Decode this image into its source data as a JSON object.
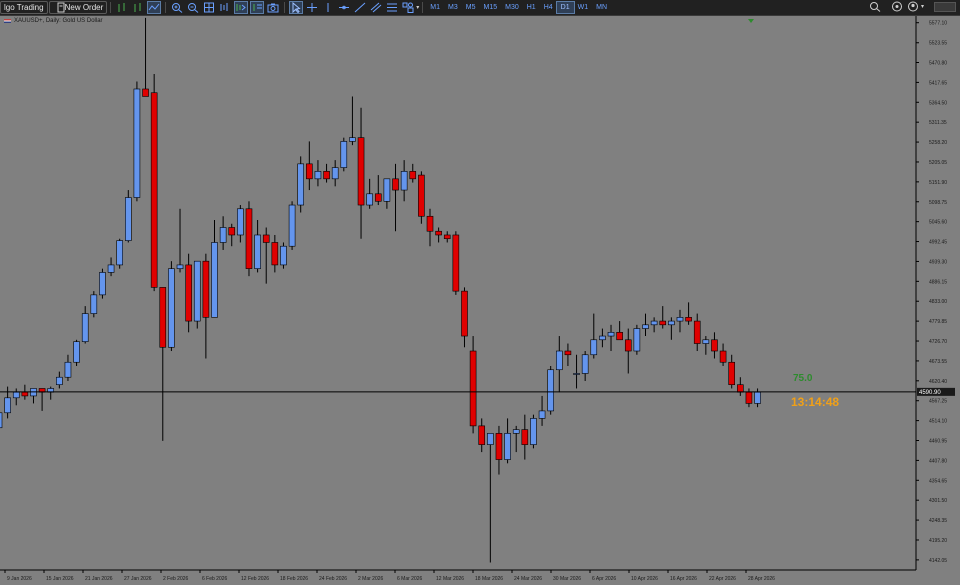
{
  "toolbar": {
    "algo_trading_label": "lgo Trading",
    "new_order_label": "New Order",
    "timeframes": [
      "M1",
      "M3",
      "M5",
      "M15",
      "M30",
      "H1",
      "H4",
      "D1",
      "W1",
      "MN"
    ],
    "active_timeframe": "D1"
  },
  "chart": {
    "symbol_label": "XAUUSD+, Daily: Gold US Dollar",
    "background_color": "#808080",
    "bull_color": "#6495ed",
    "bear_color": "#e00000",
    "price_levels": [
      "5577.10",
      "5523.55",
      "5470.80",
      "5417.65",
      "5364.50",
      "5311.35",
      "5258.20",
      "5205.05",
      "5151.90",
      "5098.75",
      "5045.60",
      "4992.45",
      "4939.30",
      "4886.15",
      "4833.00",
      "4779.85",
      "4726.70",
      "4673.55",
      "4620.40",
      "4567.25",
      "4514.10",
      "4460.95",
      "4407.80",
      "4354.65",
      "4301.50",
      "4248.35",
      "4195.20",
      "4142.05"
    ],
    "current_price": "4590.90",
    "date_labels": [
      "9 Jan 2026",
      "15 Jan 2026",
      "21 Jan 2026",
      "27 Jan 2026",
      "2 Feb 2026",
      "6 Feb 2026",
      "12 Feb 2026",
      "18 Feb 2026",
      "24 Feb 2026",
      "2 Mar 2026",
      "6 Mar 2026",
      "12 Mar 2026",
      "18 Mar 2026",
      "24 Mar 2026",
      "30 Mar 2026",
      "6 Apr 2026",
      "10 Apr 2026",
      "16 Apr 2026",
      "22 Apr 2026",
      "28 Apr 2026"
    ],
    "spread_label": "75.0",
    "countdown": "13:14:48"
  },
  "chart_data": {
    "type": "candlestick",
    "y_range": [
      4115,
      5595
    ],
    "candles": [
      {
        "o": 4495,
        "h": 4560,
        "l": 4480,
        "c": 4535
      },
      {
        "o": 4535,
        "h": 4605,
        "l": 4520,
        "c": 4575
      },
      {
        "o": 4575,
        "h": 4600,
        "l": 4555,
        "c": 4590
      },
      {
        "o": 4590,
        "h": 4610,
        "l": 4570,
        "c": 4580
      },
      {
        "o": 4580,
        "h": 4600,
        "l": 4560,
        "c": 4600
      },
      {
        "o": 4600,
        "h": 4600,
        "l": 4540,
        "c": 4590
      },
      {
        "o": 4590,
        "h": 4605,
        "l": 4570,
        "c": 4600
      },
      {
        "o": 4610,
        "h": 4645,
        "l": 4600,
        "c": 4630
      },
      {
        "o": 4630,
        "h": 4690,
        "l": 4620,
        "c": 4670
      },
      {
        "o": 4670,
        "h": 4730,
        "l": 4660,
        "c": 4725
      },
      {
        "o": 4725,
        "h": 4820,
        "l": 4720,
        "c": 4800
      },
      {
        "o": 4800,
        "h": 4860,
        "l": 4790,
        "c": 4850
      },
      {
        "o": 4850,
        "h": 4920,
        "l": 4840,
        "c": 4910
      },
      {
        "o": 4910,
        "h": 4950,
        "l": 4900,
        "c": 4930
      },
      {
        "o": 4930,
        "h": 5000,
        "l": 4920,
        "c": 4995
      },
      {
        "o": 4995,
        "h": 5130,
        "l": 4990,
        "c": 5110
      },
      {
        "o": 5110,
        "h": 5420,
        "l": 5100,
        "c": 5400
      },
      {
        "o": 5400,
        "h": 5590,
        "l": 5390,
        "c": 5380
      },
      {
        "o": 5390,
        "h": 5440,
        "l": 4860,
        "c": 4870
      },
      {
        "o": 4870,
        "h": 4870,
        "l": 4460,
        "c": 4710
      },
      {
        "o": 4710,
        "h": 4940,
        "l": 4700,
        "c": 4920
      },
      {
        "o": 4920,
        "h": 5080,
        "l": 4910,
        "c": 4930
      },
      {
        "o": 4930,
        "h": 4960,
        "l": 4750,
        "c": 4780
      },
      {
        "o": 4780,
        "h": 4900,
        "l": 4760,
        "c": 4940
      },
      {
        "o": 4940,
        "h": 4960,
        "l": 4680,
        "c": 4790
      },
      {
        "o": 4790,
        "h": 5050,
        "l": 4790,
        "c": 4990
      },
      {
        "o": 4990,
        "h": 5060,
        "l": 4970,
        "c": 5030
      },
      {
        "o": 5030,
        "h": 5040,
        "l": 4980,
        "c": 5010
      },
      {
        "o": 5010,
        "h": 5090,
        "l": 4990,
        "c": 5080
      },
      {
        "o": 5080,
        "h": 5100,
        "l": 4900,
        "c": 4920
      },
      {
        "o": 4920,
        "h": 5050,
        "l": 4910,
        "c": 5010
      },
      {
        "o": 5010,
        "h": 5030,
        "l": 4880,
        "c": 4990
      },
      {
        "o": 4990,
        "h": 5010,
        "l": 4910,
        "c": 4930
      },
      {
        "o": 4930,
        "h": 4990,
        "l": 4920,
        "c": 4980
      },
      {
        "o": 4980,
        "h": 5100,
        "l": 4970,
        "c": 5090
      },
      {
        "o": 5090,
        "h": 5220,
        "l": 5070,
        "c": 5200
      },
      {
        "o": 5200,
        "h": 5260,
        "l": 5130,
        "c": 5160
      },
      {
        "o": 5160,
        "h": 5210,
        "l": 5140,
        "c": 5180
      },
      {
        "o": 5180,
        "h": 5200,
        "l": 5150,
        "c": 5160
      },
      {
        "o": 5160,
        "h": 5210,
        "l": 5140,
        "c": 5190
      },
      {
        "o": 5190,
        "h": 5270,
        "l": 5180,
        "c": 5260
      },
      {
        "o": 5260,
        "h": 5380,
        "l": 5250,
        "c": 5270
      },
      {
        "o": 5270,
        "h": 5350,
        "l": 5000,
        "c": 5090
      },
      {
        "o": 5090,
        "h": 5160,
        "l": 5080,
        "c": 5120
      },
      {
        "o": 5120,
        "h": 5170,
        "l": 5090,
        "c": 5100
      },
      {
        "o": 5100,
        "h": 5150,
        "l": 5080,
        "c": 5160
      },
      {
        "o": 5160,
        "h": 5200,
        "l": 5020,
        "c": 5130
      },
      {
        "o": 5130,
        "h": 5210,
        "l": 5100,
        "c": 5180
      },
      {
        "o": 5180,
        "h": 5200,
        "l": 5150,
        "c": 5160
      },
      {
        "o": 5170,
        "h": 5180,
        "l": 5040,
        "c": 5060
      },
      {
        "o": 5060,
        "h": 5080,
        "l": 4980,
        "c": 5020
      },
      {
        "o": 5020,
        "h": 5030,
        "l": 4990,
        "c": 5010
      },
      {
        "o": 5010,
        "h": 5020,
        "l": 4990,
        "c": 5000
      },
      {
        "o": 5010,
        "h": 5020,
        "l": 4850,
        "c": 4860
      },
      {
        "o": 4860,
        "h": 4870,
        "l": 4710,
        "c": 4740
      },
      {
        "o": 4700,
        "h": 4740,
        "l": 4480,
        "c": 4500
      },
      {
        "o": 4500,
        "h": 4520,
        "l": 4430,
        "c": 4450
      },
      {
        "o": 4450,
        "h": 4460,
        "l": 4135,
        "c": 4480
      },
      {
        "o": 4480,
        "h": 4500,
        "l": 4370,
        "c": 4410
      },
      {
        "o": 4410,
        "h": 4520,
        "l": 4400,
        "c": 4480
      },
      {
        "o": 4480,
        "h": 4500,
        "l": 4430,
        "c": 4490
      },
      {
        "o": 4490,
        "h": 4530,
        "l": 4410,
        "c": 4450
      },
      {
        "o": 4450,
        "h": 4530,
        "l": 4440,
        "c": 4520
      },
      {
        "o": 4520,
        "h": 4580,
        "l": 4500,
        "c": 4540
      },
      {
        "o": 4540,
        "h": 4660,
        "l": 4530,
        "c": 4650
      },
      {
        "o": 4650,
        "h": 4740,
        "l": 4590,
        "c": 4700
      },
      {
        "o": 4700,
        "h": 4720,
        "l": 4660,
        "c": 4690
      },
      {
        "o": 4640,
        "h": 4690,
        "l": 4600,
        "c": 4640
      },
      {
        "o": 4640,
        "h": 4700,
        "l": 4620,
        "c": 4690
      },
      {
        "o": 4690,
        "h": 4800,
        "l": 4680,
        "c": 4730
      },
      {
        "o": 4730,
        "h": 4760,
        "l": 4710,
        "c": 4740
      },
      {
        "o": 4740,
        "h": 4770,
        "l": 4700,
        "c": 4750
      },
      {
        "o": 4750,
        "h": 4780,
        "l": 4730,
        "c": 4730
      },
      {
        "o": 4730,
        "h": 4760,
        "l": 4640,
        "c": 4700
      },
      {
        "o": 4700,
        "h": 4770,
        "l": 4690,
        "c": 4760
      },
      {
        "o": 4760,
        "h": 4800,
        "l": 4740,
        "c": 4770
      },
      {
        "o": 4770,
        "h": 4790,
        "l": 4750,
        "c": 4780
      },
      {
        "o": 4780,
        "h": 4820,
        "l": 4760,
        "c": 4770
      },
      {
        "o": 4770,
        "h": 4790,
        "l": 4730,
        "c": 4780
      },
      {
        "o": 4780,
        "h": 4810,
        "l": 4750,
        "c": 4790
      },
      {
        "o": 4790,
        "h": 4830,
        "l": 4770,
        "c": 4780
      },
      {
        "o": 4780,
        "h": 4800,
        "l": 4700,
        "c": 4720
      },
      {
        "o": 4720,
        "h": 4740,
        "l": 4690,
        "c": 4730
      },
      {
        "o": 4730,
        "h": 4750,
        "l": 4680,
        "c": 4700
      },
      {
        "o": 4700,
        "h": 4720,
        "l": 4660,
        "c": 4670
      },
      {
        "o": 4670,
        "h": 4690,
        "l": 4600,
        "c": 4610
      },
      {
        "o": 4610,
        "h": 4630,
        "l": 4580,
        "c": 4590
      },
      {
        "o": 4590,
        "h": 4600,
        "l": 4550,
        "c": 4560
      },
      {
        "o": 4560,
        "h": 4600,
        "l": 4550,
        "c": 4590
      }
    ]
  }
}
